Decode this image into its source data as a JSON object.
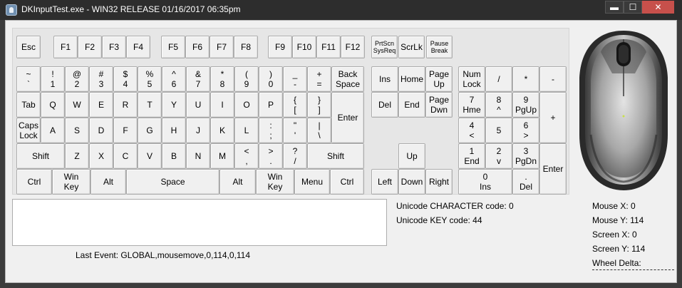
{
  "window": {
    "title": "DKInputTest.exe - WIN32 RELEASE 01/16/2017 06:35pm",
    "minimize": "▬",
    "maximize": "☐",
    "close": "✕"
  },
  "keyboard": {
    "keys": [
      {
        "id": "esc",
        "label": "Esc"
      },
      {
        "id": "f1",
        "label": "F1"
      },
      {
        "id": "f2",
        "label": "F2"
      },
      {
        "id": "f3",
        "label": "F3"
      },
      {
        "id": "f4",
        "label": "F4"
      },
      {
        "id": "f5",
        "label": "F5"
      },
      {
        "id": "f6",
        "label": "F6"
      },
      {
        "id": "f7",
        "label": "F7"
      },
      {
        "id": "f8",
        "label": "F8"
      },
      {
        "id": "f9",
        "label": "F9"
      },
      {
        "id": "f10",
        "label": "F10"
      },
      {
        "id": "f11",
        "label": "F11"
      },
      {
        "id": "f12",
        "label": "F12"
      },
      {
        "id": "prtscn",
        "label": "PrtScn\nSysReq"
      },
      {
        "id": "scrlk",
        "label": "ScrLk"
      },
      {
        "id": "pause",
        "label": "Pause\nBreak"
      },
      {
        "id": "tilde",
        "label": "~\n`"
      },
      {
        "id": "1",
        "label": "!\n1"
      },
      {
        "id": "2",
        "label": "@\n2"
      },
      {
        "id": "3",
        "label": "#\n3"
      },
      {
        "id": "4",
        "label": "$\n4"
      },
      {
        "id": "5",
        "label": "%\n5"
      },
      {
        "id": "6",
        "label": "^\n6"
      },
      {
        "id": "7",
        "label": "&\n7"
      },
      {
        "id": "8",
        "label": "*\n8"
      },
      {
        "id": "9",
        "label": "(\n9"
      },
      {
        "id": "0",
        "label": ")\n0"
      },
      {
        "id": "minus",
        "label": "_\n-"
      },
      {
        "id": "equals",
        "label": "+\n="
      },
      {
        "id": "backspace",
        "label": "Back\nSpace"
      },
      {
        "id": "ins",
        "label": "Ins"
      },
      {
        "id": "home",
        "label": "Home"
      },
      {
        "id": "pgup",
        "label": "Page\nUp"
      },
      {
        "id": "numlock",
        "label": "Num\nLock"
      },
      {
        "id": "numdiv",
        "label": "/"
      },
      {
        "id": "nummul",
        "label": "*"
      },
      {
        "id": "numsub",
        "label": "-"
      },
      {
        "id": "tab",
        "label": "Tab"
      },
      {
        "id": "q",
        "label": "Q"
      },
      {
        "id": "w",
        "label": "W"
      },
      {
        "id": "e",
        "label": "E"
      },
      {
        "id": "r",
        "label": "R"
      },
      {
        "id": "t",
        "label": "T"
      },
      {
        "id": "y",
        "label": "Y"
      },
      {
        "id": "u",
        "label": "U"
      },
      {
        "id": "i",
        "label": "I"
      },
      {
        "id": "o",
        "label": "O"
      },
      {
        "id": "p",
        "label": "P"
      },
      {
        "id": "lbracket",
        "label": "{\n["
      },
      {
        "id": "rbracket",
        "label": "}\n]"
      },
      {
        "id": "enter",
        "label": "Enter"
      },
      {
        "id": "del",
        "label": "Del"
      },
      {
        "id": "end",
        "label": "End"
      },
      {
        "id": "pgdn",
        "label": "Page\nDwn"
      },
      {
        "id": "num7",
        "label": "7\nHme"
      },
      {
        "id": "num8",
        "label": "8\n^"
      },
      {
        "id": "num9",
        "label": "9\nPgUp"
      },
      {
        "id": "numadd",
        "label": "+"
      },
      {
        "id": "caps",
        "label": "Caps\nLock"
      },
      {
        "id": "a",
        "label": "A"
      },
      {
        "id": "s",
        "label": "S"
      },
      {
        "id": "d",
        "label": "D"
      },
      {
        "id": "f",
        "label": "F"
      },
      {
        "id": "g",
        "label": "G"
      },
      {
        "id": "h",
        "label": "H"
      },
      {
        "id": "j",
        "label": "J"
      },
      {
        "id": "k",
        "label": "K"
      },
      {
        "id": "l",
        "label": "L"
      },
      {
        "id": "semicolon",
        "label": ":\n;"
      },
      {
        "id": "quote",
        "label": "\"\n'"
      },
      {
        "id": "backslash",
        "label": "|\n\\"
      },
      {
        "id": "num4",
        "label": "4\n<"
      },
      {
        "id": "num5",
        "label": "5"
      },
      {
        "id": "num6",
        "label": "6\n>"
      },
      {
        "id": "lshift",
        "label": "Shift"
      },
      {
        "id": "z",
        "label": "Z"
      },
      {
        "id": "x",
        "label": "X"
      },
      {
        "id": "c",
        "label": "C"
      },
      {
        "id": "v",
        "label": "V"
      },
      {
        "id": "b",
        "label": "B"
      },
      {
        "id": "n",
        "label": "N"
      },
      {
        "id": "m",
        "label": "M"
      },
      {
        "id": "comma",
        "label": "<\n,"
      },
      {
        "id": "period",
        "label": ">\n."
      },
      {
        "id": "slash",
        "label": "?\n/"
      },
      {
        "id": "rshift",
        "label": "Shift"
      },
      {
        "id": "up",
        "label": "Up"
      },
      {
        "id": "num1",
        "label": "1\nEnd"
      },
      {
        "id": "num2",
        "label": "2\nv"
      },
      {
        "id": "num3",
        "label": "3\nPgDn"
      },
      {
        "id": "numenter",
        "label": "Enter"
      },
      {
        "id": "lctrl",
        "label": "Ctrl"
      },
      {
        "id": "lwin",
        "label": "Win\nKey"
      },
      {
        "id": "lalt",
        "label": "Alt"
      },
      {
        "id": "space",
        "label": "Space"
      },
      {
        "id": "ralt",
        "label": "Alt"
      },
      {
        "id": "rwin",
        "label": "Win\nKey"
      },
      {
        "id": "menu",
        "label": "Menu"
      },
      {
        "id": "rctrl",
        "label": "Ctrl"
      },
      {
        "id": "left",
        "label": "Left"
      },
      {
        "id": "down",
        "label": "Down"
      },
      {
        "id": "right",
        "label": "Right"
      },
      {
        "id": "num0",
        "label": "0\nIns"
      },
      {
        "id": "numdec",
        "label": ".\nDel"
      }
    ]
  },
  "status": {
    "last_event": "Last Event: GLOBAL,mousemove,0,114,0,114",
    "unicode_char": "Unicode CHARACTER code: 0",
    "unicode_key": "Unicode KEY code: 44",
    "mouse_x": "Mouse X: 0",
    "mouse_y": "Mouse Y: 114",
    "screen_x": "Screen X: 0",
    "screen_y": "Screen Y: 114",
    "wheel_delta": "Wheel Delta:"
  },
  "event_log": {
    "value": ""
  },
  "colors": {
    "key_face": "#f0f0f0",
    "key_border": "#acacac",
    "panel": "#e6e6e6",
    "titlebar": "#2d2d2d"
  }
}
